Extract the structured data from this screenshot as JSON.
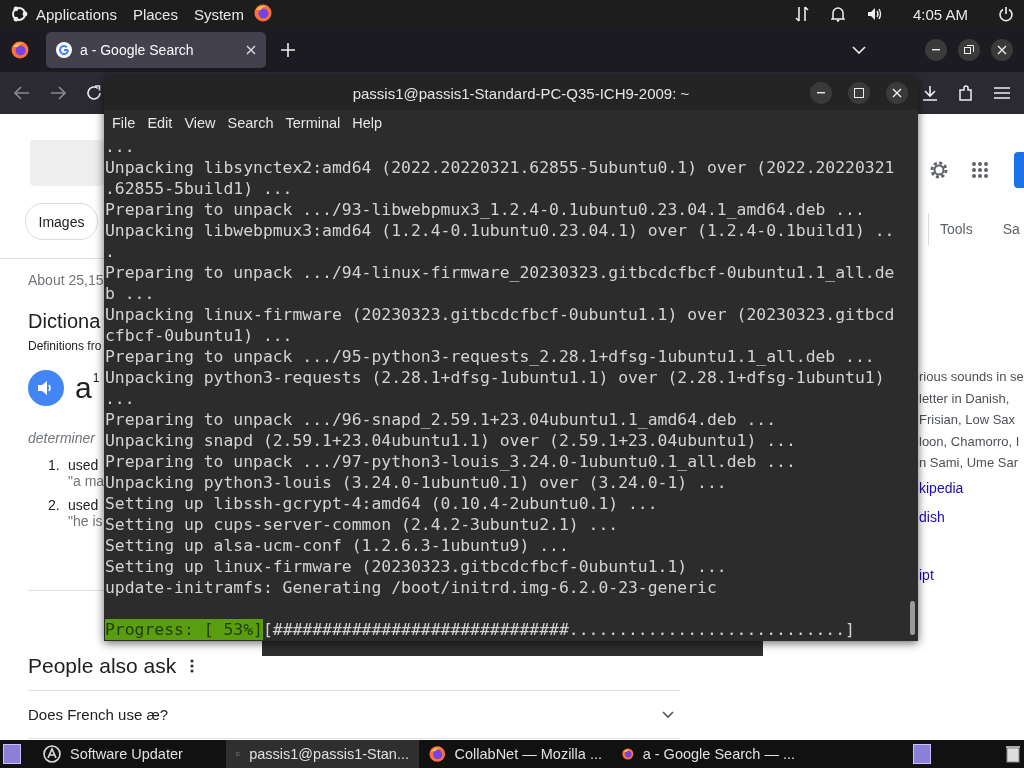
{
  "top_panel": {
    "menus": [
      "Applications",
      "Places",
      "System"
    ],
    "clock": "4:05 AM"
  },
  "browser": {
    "tabs": [
      {
        "title": "a - Google Search",
        "selected": true
      }
    ],
    "page": {
      "chip": "Images",
      "result_count": "About 25,15",
      "heading": "Dictiona",
      "source": "Definitions fro",
      "word": "a",
      "superscript": "1",
      "part_of_speech": "determiner",
      "senses": [
        {
          "number": "1.",
          "text": "used",
          "example": "\"a ma"
        },
        {
          "number": "2.",
          "text": "used",
          "example": "\"he is"
        }
      ],
      "people_also_ask": "People also ask",
      "questions": [
        {
          "text": "Does French use æ?",
          "expanded": false
        }
      ],
      "tools": "Tools",
      "cut_tab": "Sa",
      "side_lines": [
        {
          "text": "rious sounds in se",
          "kind": "text"
        },
        {
          "text": "letter in Danish,",
          "kind": "text"
        },
        {
          "text": "Frisian, Low Sax",
          "kind": "text"
        },
        {
          "text": "loon, Chamorro, I",
          "kind": "text"
        },
        {
          "text": "n Sami, Ume Sar",
          "kind": "text"
        },
        {
          "text": "kipedia",
          "kind": "link"
        },
        {
          "text": "dish",
          "kind": "link"
        },
        {
          "text": "ipt",
          "kind": "link"
        }
      ]
    }
  },
  "terminal": {
    "title": "passis1@passis1-Standard-PC-Q35-ICH9-2009: ~",
    "menu": [
      "File",
      "Edit",
      "View",
      "Search",
      "Terminal",
      "Help"
    ],
    "lines": [
      "...",
      "Unpacking libsynctex2:amd64 (2022.20220321.62855-5ubuntu0.1) over (2022.20220321",
      ".62855-5build1) ...",
      "Preparing to unpack .../93-libwebpmux3_1.2.4-0.1ubuntu0.23.04.1_amd64.deb ...",
      "Unpacking libwebpmux3:amd64 (1.2.4-0.1ubuntu0.23.04.1) over (1.2.4-0.1build1) ..",
      ".",
      "Preparing to unpack .../94-linux-firmware_20230323.gitbcdcfbcf-0ubuntu1.1_all.de",
      "b ...",
      "Unpacking linux-firmware (20230323.gitbcdcfbcf-0ubuntu1.1) over (20230323.gitbcd",
      "cfbcf-0ubuntu1) ...",
      "Preparing to unpack .../95-python3-requests_2.28.1+dfsg-1ubuntu1.1_all.deb ...",
      "Unpacking python3-requests (2.28.1+dfsg-1ubuntu1.1) over (2.28.1+dfsg-1ubuntu1)",
      "...",
      "Preparing to unpack .../96-snapd_2.59.1+23.04ubuntu1.1_amd64.deb ...",
      "Unpacking snapd (2.59.1+23.04ubuntu1.1) over (2.59.1+23.04ubuntu1) ...",
      "Preparing to unpack .../97-python3-louis_3.24.0-1ubuntu0.1_all.deb ...",
      "Unpacking python3-louis (3.24.0-1ubuntu0.1) over (3.24.0-1) ...",
      "Setting up libssh-gcrypt-4:amd64 (0.10.4-2ubuntu0.1) ...",
      "Setting up cups-server-common (2.4.2-3ubuntu2.1) ...",
      "Setting up alsa-ucm-conf (1.2.6.3-1ubuntu9) ...",
      "Setting up linux-firmware (20230323.gitbcdcfbcf-0ubuntu1.1) ...",
      "update-initramfs: Generating /boot/initrd.img-6.2.0-23-generic"
    ],
    "progress_label": "Progress: [ 53%]",
    "progress_bar": "[##############################............................]"
  },
  "taskbar": {
    "items": [
      {
        "label": "Software Updater",
        "kind": "updater",
        "selected": false
      },
      {
        "label": "passis1@passis1-Stan...",
        "kind": "terminal",
        "selected": true
      },
      {
        "label": "CollabNet — Mozilla ...",
        "kind": "firefox",
        "selected": false
      },
      {
        "label": "a - Google Search — ...",
        "kind": "firefox",
        "selected": false
      }
    ]
  }
}
